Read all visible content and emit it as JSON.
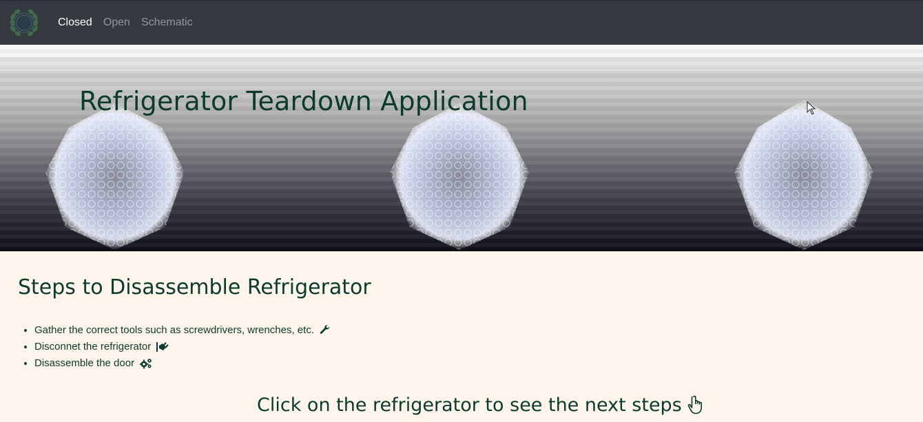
{
  "navbar": {
    "logo": "laurel-wreath-logo",
    "links": [
      {
        "label": "Closed",
        "active": true
      },
      {
        "label": "Open",
        "active": false
      },
      {
        "label": "Schematic",
        "active": false
      }
    ]
  },
  "hero": {
    "title": "Refrigerator Teardown Application"
  },
  "steps": {
    "title": "Steps to Disassemble Refrigerator",
    "items": [
      {
        "text": "Gather the correct tools such as screwdrivers, wrenches, etc.",
        "icon": "wrench-icon"
      },
      {
        "text": "Disconnet the refrigerator",
        "icon": "plug-icon"
      },
      {
        "text": "Disassemble the door",
        "icon": "gears-icon"
      }
    ]
  },
  "cta": {
    "text": "Click on the refrigerator to see the next steps",
    "icon": "hand-pointer-icon"
  },
  "colors": {
    "navbar_bg": "#343a40",
    "page_bg": "#fdf4eb",
    "text_dark_green": "#0b3a2e"
  }
}
